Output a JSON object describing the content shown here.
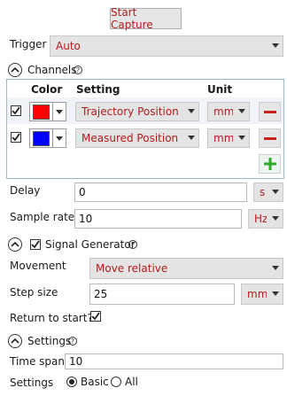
{
  "start_capture_label": "Start Capture",
  "trigger": {
    "label": "Trigger",
    "value": "Auto"
  },
  "channels": {
    "title": "Channels",
    "headers": {
      "color": "Color",
      "setting": "Setting",
      "unit": "Unit"
    },
    "rows": [
      {
        "color": "#ff0000",
        "setting": "Trajectory Position (pos)",
        "unit": "mm"
      },
      {
        "color": "#0000ff",
        "setting": "Measured Position (enc)",
        "unit": "mm"
      }
    ]
  },
  "delay": {
    "label": "Delay",
    "value": "0",
    "unit": "s"
  },
  "sample_rate": {
    "label": "Sample rate",
    "value": "10",
    "unit": "Hz"
  },
  "signal_generator": {
    "title": "Signal Generator",
    "movement_label": "Movement",
    "movement_value": "Move relative",
    "step_label": "Step size",
    "step_value": "25",
    "step_unit": "mm",
    "return_label": "Return to start?"
  },
  "settings": {
    "title": "Settings",
    "timespan_label": "Time span",
    "timespan_value": "10",
    "settings_label": "Settings",
    "option_basic": "Basic",
    "option_all": "All"
  },
  "colors": {
    "accent_text": "#b01c1c",
    "remove": "#cc2020",
    "add": "#2eaa2e"
  }
}
